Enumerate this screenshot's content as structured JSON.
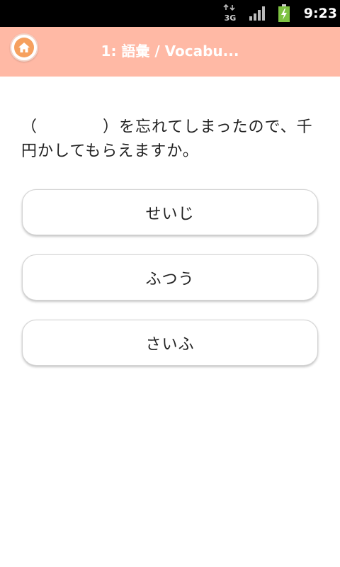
{
  "status_bar": {
    "network_type": "3G",
    "time": "9:23",
    "icons": [
      "network-3g-icon",
      "signal-strength-icon",
      "battery-charging-icon"
    ],
    "battery_color": "#7ec242"
  },
  "app_bar": {
    "title": "1: 語彙 / Vocabu...",
    "home_icon": "home-icon",
    "background_color": "#ffb9a5"
  },
  "question": {
    "text": "（　　　　）を忘れてしまったので、千円かしてもらえますか。"
  },
  "answers": [
    {
      "label": "せいじ"
    },
    {
      "label": "ふつう"
    },
    {
      "label": "さいふ"
    }
  ]
}
